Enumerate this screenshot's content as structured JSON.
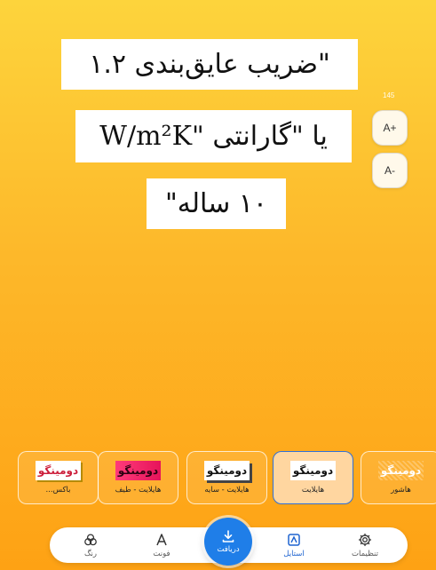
{
  "quote": {
    "line1": "\"ضریب عایق‌بندی ۱.۲",
    "line2": "W/m²K\" یا \"گارانتی",
    "line3": "۱۰ ساله\""
  },
  "size_controls": {
    "readout": "145",
    "increase_label": "A+",
    "decrease_label": "A-"
  },
  "styles": [
    {
      "preview": "دومینگو",
      "label": "باکس..."
    },
    {
      "preview": "دومینگو",
      "label": "هایلایت - طیف"
    },
    {
      "preview": "دومینگو",
      "label": "هایلایت - سایه"
    },
    {
      "preview": "دومینگو",
      "label": "هایلایت",
      "selected": true
    },
    {
      "preview": "دومینگو",
      "label": "هاشور"
    }
  ],
  "nav": {
    "color_label": "رنگ",
    "font_label": "فونت",
    "download_label": "دریافت",
    "style_label": "استایل",
    "settings_label": "تنظیمات",
    "active": "style"
  },
  "colors": {
    "background_top": "#fdd43c",
    "background_bottom": "#fea214",
    "accent": "#1f7ee8",
    "active_tab": "#1e63d0"
  }
}
